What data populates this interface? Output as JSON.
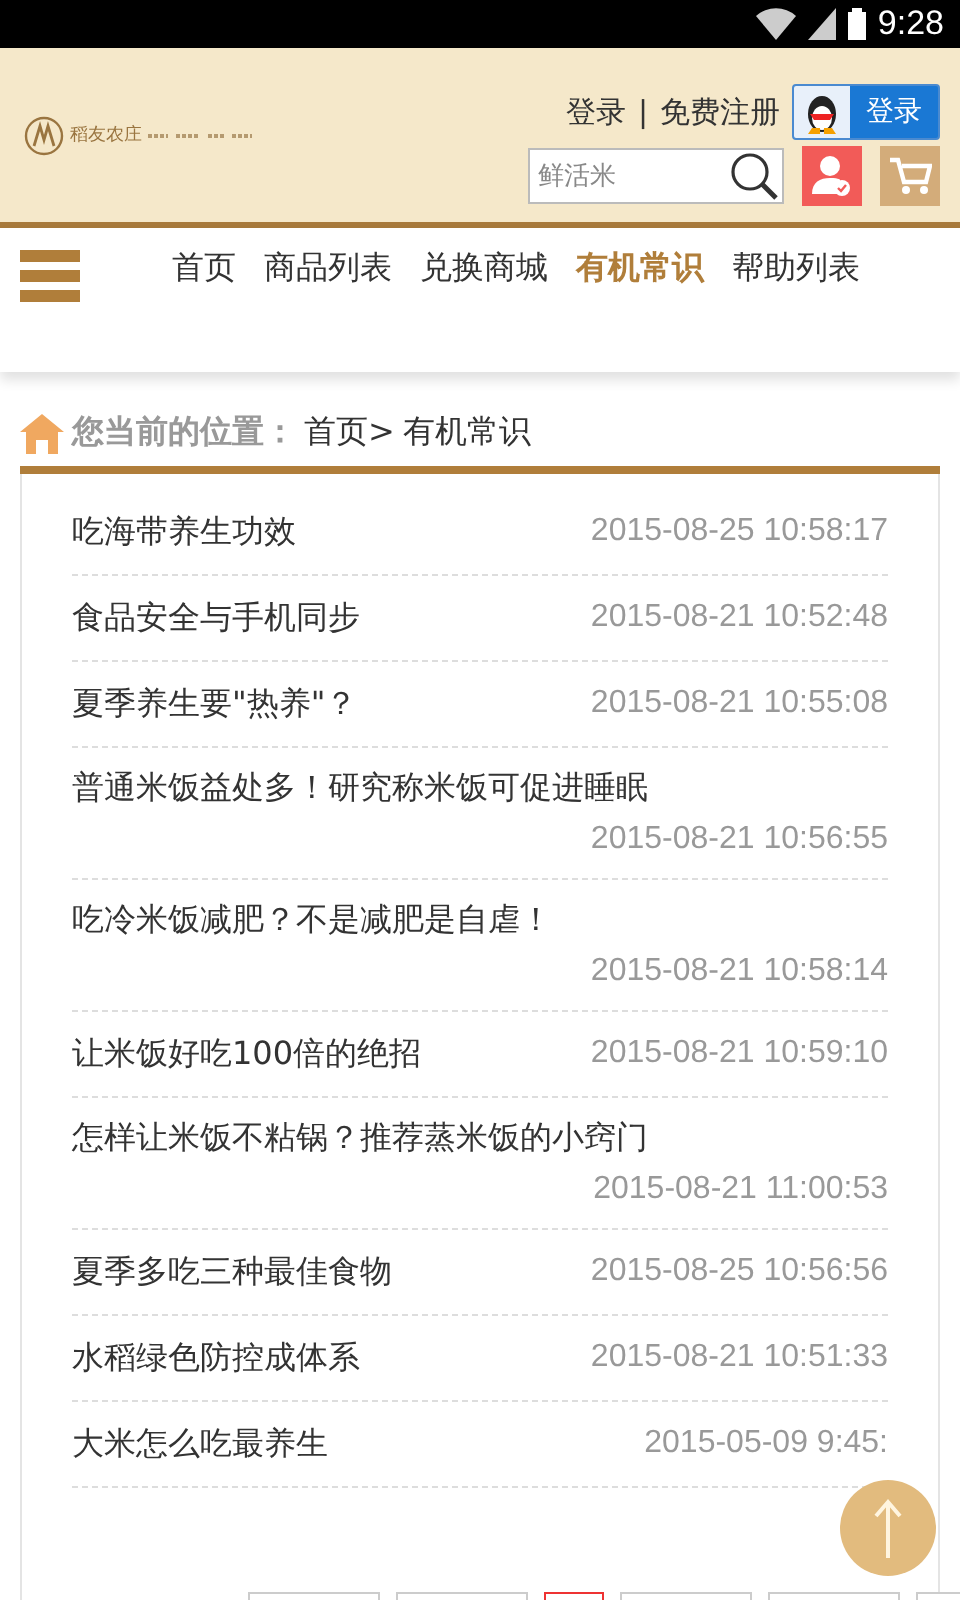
{
  "status_bar": {
    "time": "9:28"
  },
  "header": {
    "brand": "稻友农庄",
    "login_link": "登录",
    "separator": "|",
    "register_link": "免费注册",
    "qq_login": "登录",
    "search": {
      "value": "鲜活米"
    }
  },
  "nav": {
    "items": [
      {
        "label": "首页",
        "selected": false
      },
      {
        "label": "商品列表",
        "selected": false
      },
      {
        "label": "兑换商城",
        "selected": false
      },
      {
        "label": "有机常识",
        "selected": true
      },
      {
        "label": "帮助列表",
        "selected": false
      }
    ]
  },
  "breadcrumb": {
    "label": "您当前的位置：",
    "path": "首页>",
    "current": "有机常识"
  },
  "articles": [
    {
      "title": "吃海带养生功效",
      "date": "2015-08-25 10:58:17"
    },
    {
      "title": "食品安全与手机同步",
      "date": "2015-08-21 10:52:48"
    },
    {
      "title": "夏季养生要\"热养\"？",
      "date": "2015-08-21 10:55:08"
    },
    {
      "title": "普通米饭益处多！研究称米饭可促进睡眠",
      "date": "2015-08-21 10:56:55"
    },
    {
      "title": "吃冷米饭减肥？不是减肥是自虐！",
      "date": "2015-08-21 10:58:14"
    },
    {
      "title": "让米饭好吃100倍的绝招",
      "date": "2015-08-21 10:59:10"
    },
    {
      "title": "怎样让米饭不粘锅？推荐蒸米饭的小窍门",
      "date": "2015-08-21 11:00:53"
    },
    {
      "title": "夏季多吃三种最佳食物",
      "date": "2015-08-25 10:56:56"
    },
    {
      "title": "水稻绿色防控成体系",
      "date": "2015-08-21 10:51:33"
    },
    {
      "title": "大米怎么吃最养生",
      "date": "2015-05-09 9:45:"
    }
  ],
  "pager": [
    {
      "selected": false
    },
    {
      "selected": false
    },
    {
      "selected": true
    },
    {
      "selected": false
    },
    {
      "selected": false
    },
    {
      "selected": false
    }
  ]
}
